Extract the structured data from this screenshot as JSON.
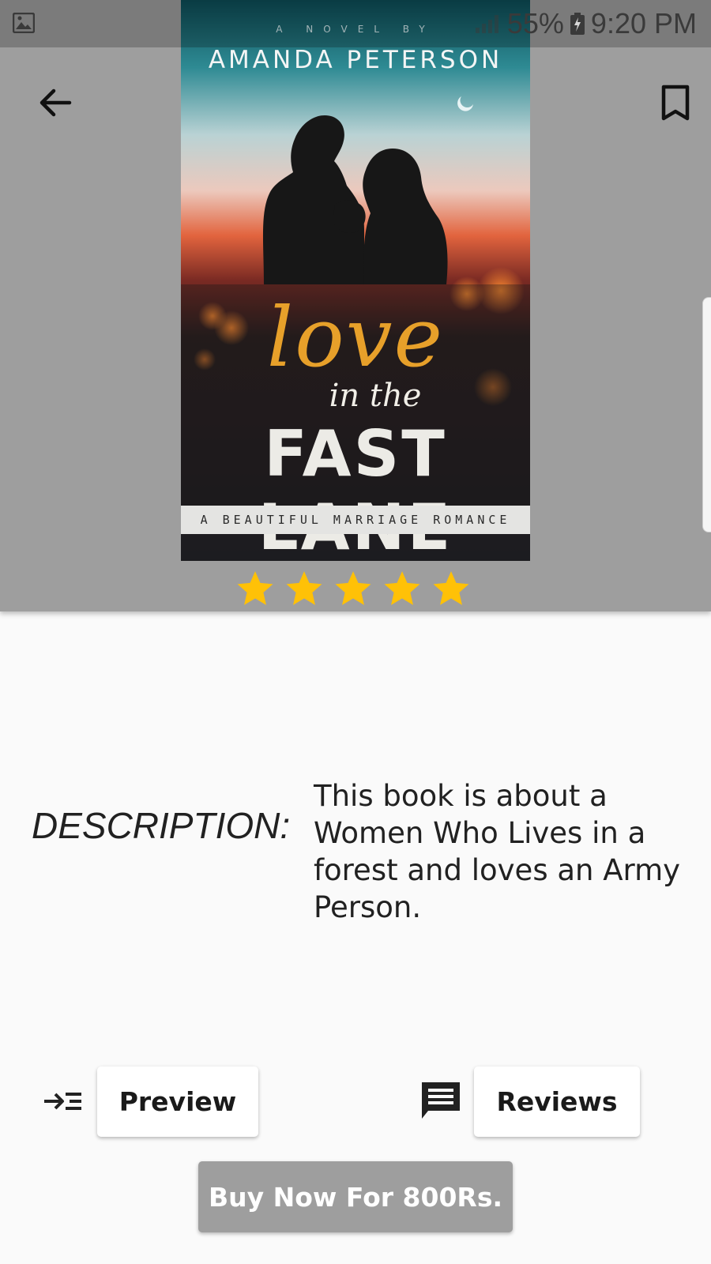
{
  "status_bar": {
    "battery": "55%",
    "time": "9:20 PM",
    "icons": [
      "gallery-icon",
      "signal-icon",
      "battery-charging-icon"
    ]
  },
  "app_bar": {
    "back_icon": "arrow-back-icon",
    "bookmark_icon": "bookmark-outline-icon"
  },
  "book": {
    "cover": {
      "kicker": "A NOVEL BY",
      "author": "AMANDA PETERSON",
      "title_line1": "love",
      "title_line2": "in the",
      "title_line3": "FAST LANE",
      "tagline": "A BEAUTIFUL MARRIAGE ROMANCE"
    },
    "rating": {
      "value": 5,
      "max": 5,
      "color": "#ffc107"
    }
  },
  "description": {
    "label": "DESCRIPTION:",
    "text": "This book is about a Women Who Lives in a forest and loves an Army Person."
  },
  "actions": {
    "preview_icon": "list-arrow-icon",
    "preview_label": "Preview",
    "reviews_icon": "comment-icon",
    "reviews_label": "Reviews",
    "buy_label": "Buy Now For 800Rs."
  },
  "colors": {
    "header_bg": "#9e9e9e",
    "page_bg": "#fafafa",
    "star": "#ffc107",
    "buy_button_bg": "#9e9e9e"
  }
}
